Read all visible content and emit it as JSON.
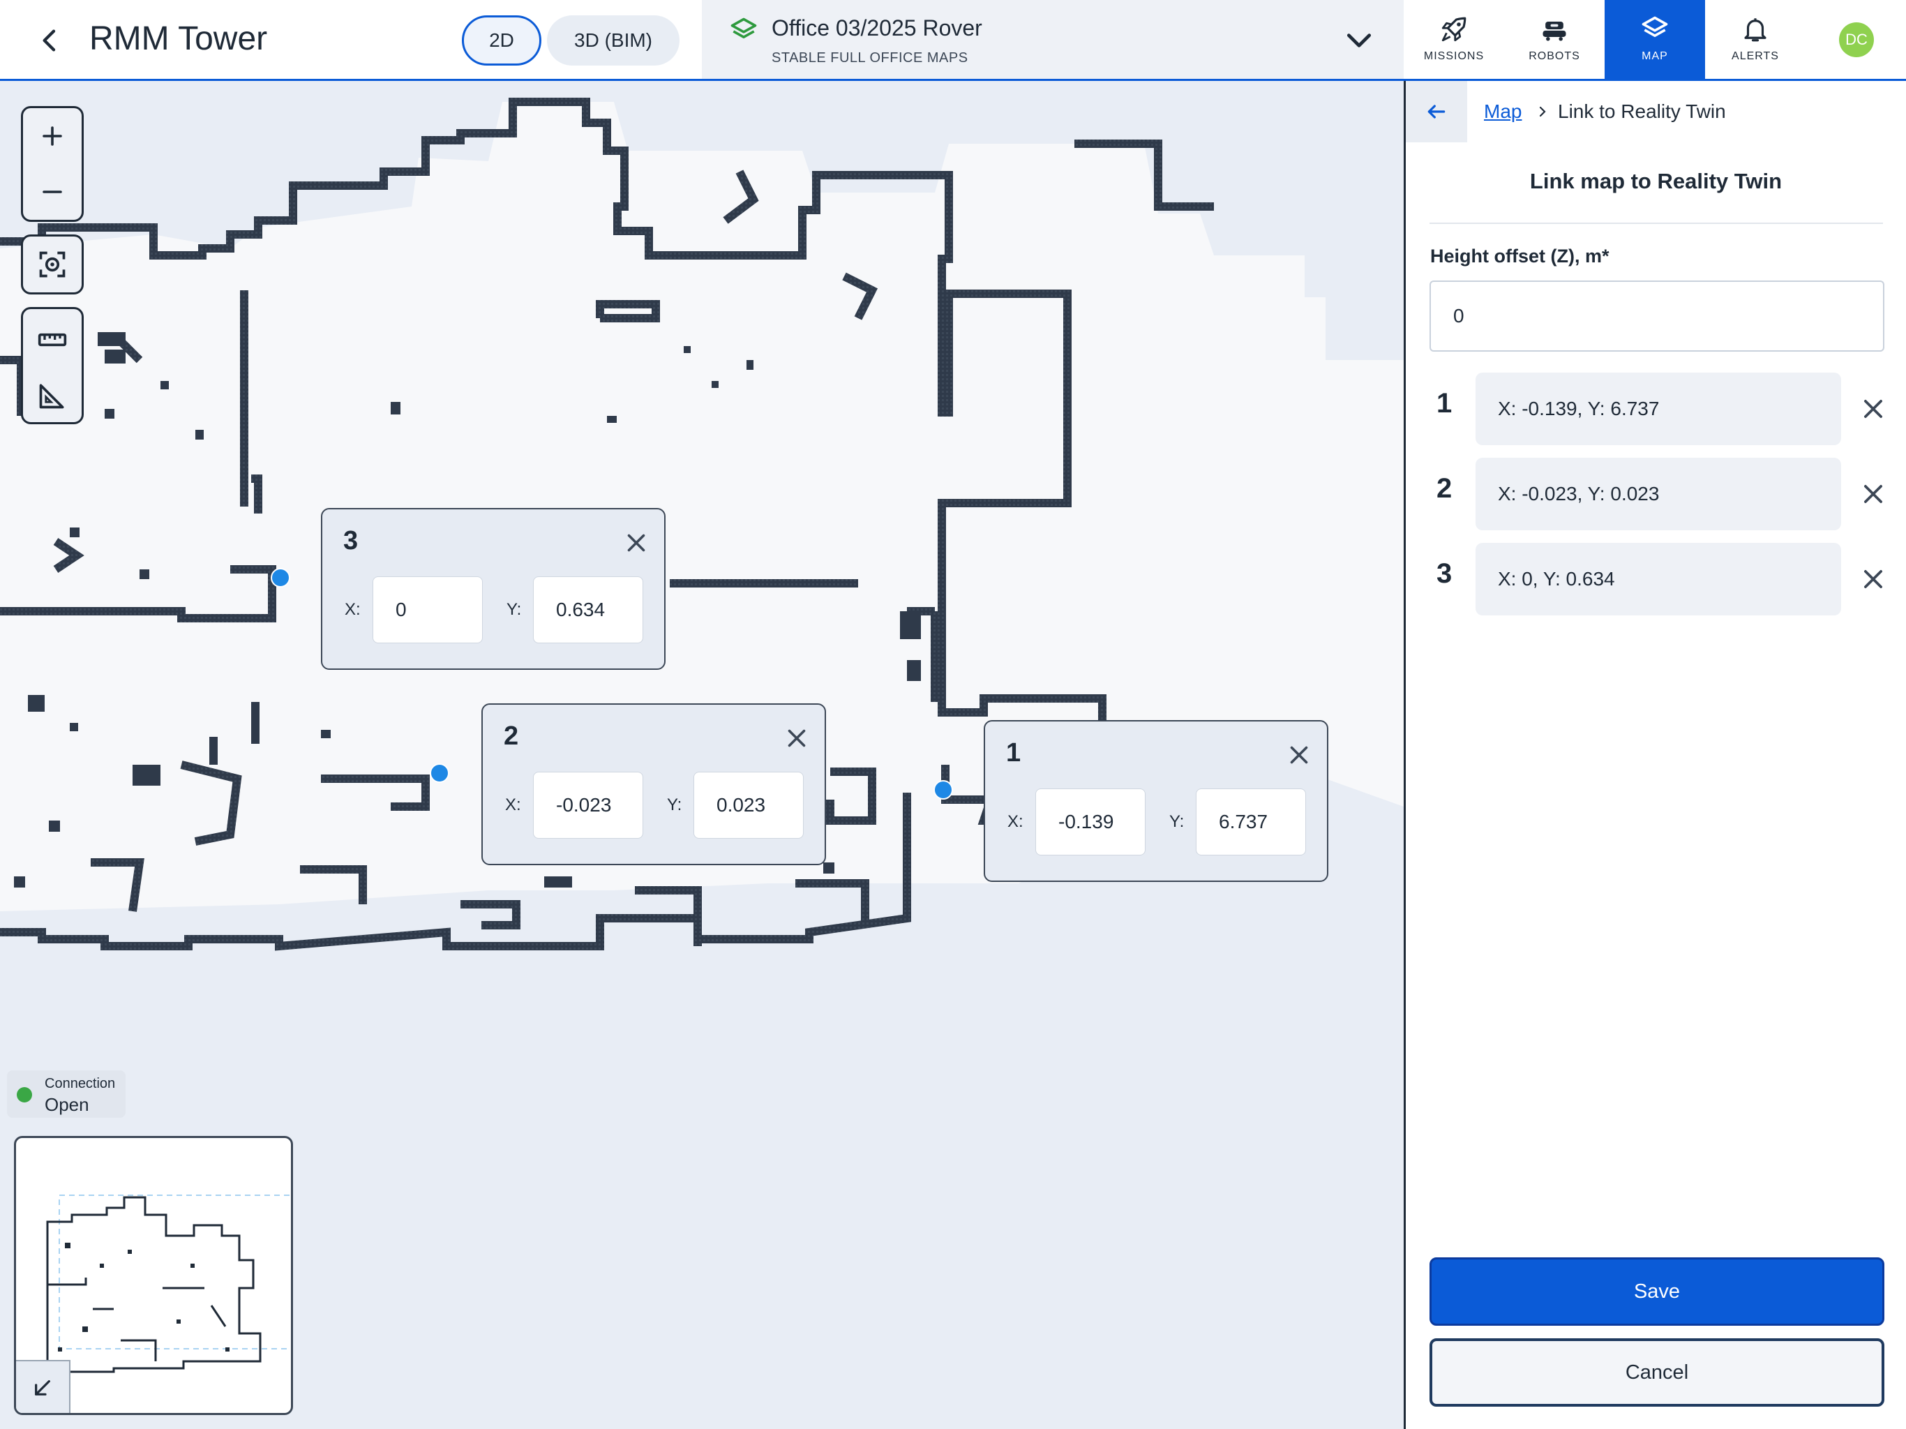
{
  "header": {
    "title": "RMM Tower",
    "view_modes": [
      "2D",
      "3D (BIM)"
    ],
    "active_view_mode": "2D",
    "map_selector": {
      "name": "Office 03/2025 Rover",
      "subtitle": "STABLE FULL OFFICE MAPS"
    },
    "nav": [
      {
        "label": "MISSIONS",
        "icon": "rocket-icon"
      },
      {
        "label": "ROBOTS",
        "icon": "robot-icon"
      },
      {
        "label": "MAP",
        "icon": "layers-icon"
      },
      {
        "label": "ALERTS",
        "icon": "bell-icon"
      }
    ],
    "active_nav": "MAP",
    "avatar_initials": "DC"
  },
  "map": {
    "points": [
      {
        "number": "3",
        "x_label": "X:",
        "x": "0",
        "y_label": "Y:",
        "y": "0.634"
      },
      {
        "number": "2",
        "x_label": "X:",
        "x": "-0.023",
        "y_label": "Y:",
        "y": "0.023"
      },
      {
        "number": "1",
        "x_label": "X:",
        "x": "-0.139",
        "y_label": "Y:",
        "y": "6.737"
      }
    ],
    "connection": {
      "label": "Connection",
      "status": "Open",
      "status_color": "#3aa745"
    }
  },
  "panel": {
    "breadcrumb": {
      "parent": "Map",
      "current": "Link to Reality Twin"
    },
    "title": "Link map to Reality Twin",
    "height_label": "Height offset (Z), m*",
    "height_value": "0",
    "points": [
      {
        "number": "1",
        "text": "X: -0.139, Y: 6.737"
      },
      {
        "number": "2",
        "text": "X: -0.023, Y: 0.023"
      },
      {
        "number": "3",
        "text": "X: 0, Y: 0.634"
      }
    ],
    "save_label": "Save",
    "cancel_label": "Cancel"
  },
  "colors": {
    "accent": "#0b5bd7",
    "pin": "#1e88e5",
    "wall": "#2f3a4a",
    "map_background": "#e8edf5",
    "avatar": "#8fd14f"
  }
}
